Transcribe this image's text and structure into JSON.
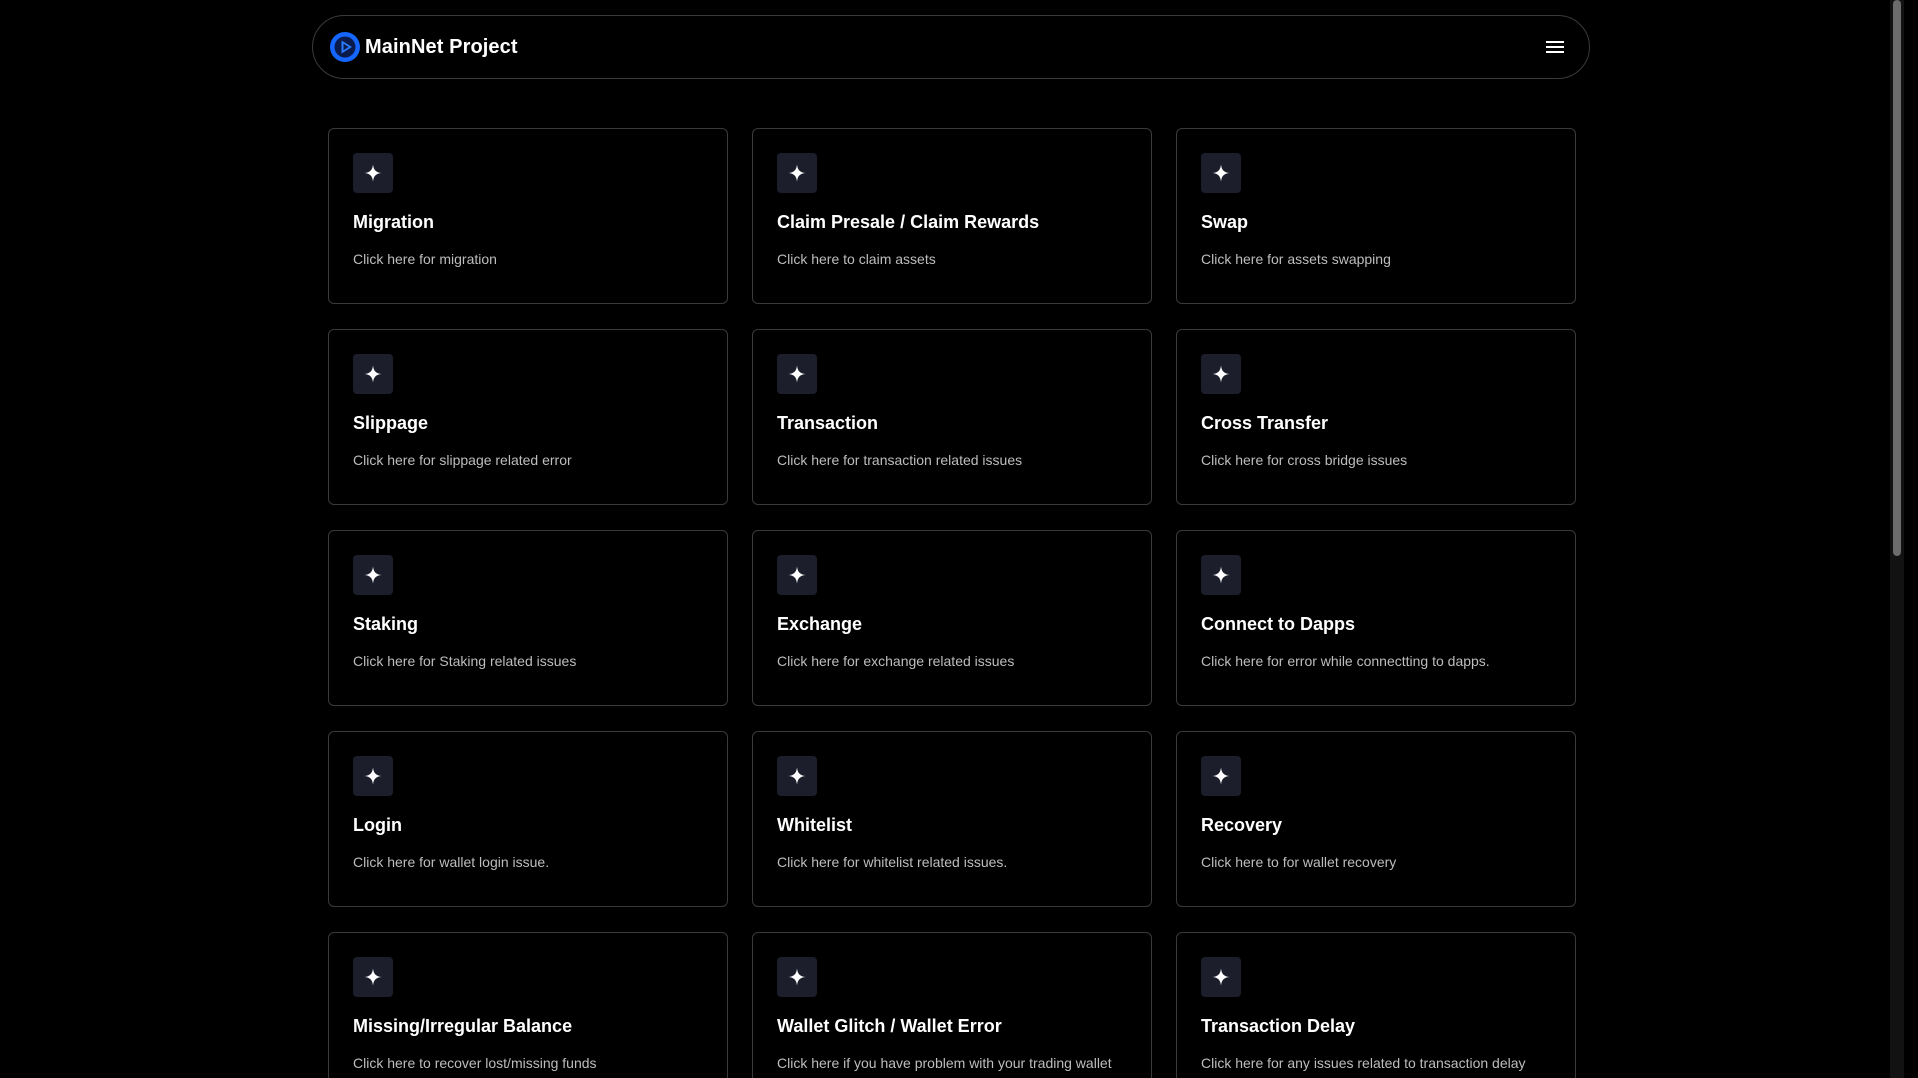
{
  "header": {
    "brand_name": "MainNet Project",
    "logo_icon": "play-circle-logo-icon",
    "menu_icon": "hamburger-menu-icon"
  },
  "colors": {
    "background": "#000000",
    "border": "#3a3a3a",
    "icon_tile": "#1c1f2b",
    "logo_blue": "#1565ff",
    "description_text": "#bdbdbd"
  },
  "cards": [
    {
      "title": "Migration",
      "description": "Click here for migration",
      "icon": "sparkle-icon"
    },
    {
      "title": "Claim Presale / Claim Rewards",
      "description": "Click here to claim assets",
      "icon": "sparkle-icon"
    },
    {
      "title": "Swap",
      "description": "Click here for assets swapping",
      "icon": "sparkle-icon"
    },
    {
      "title": "Slippage",
      "description": "Click here for slippage related error",
      "icon": "sparkle-icon"
    },
    {
      "title": "Transaction",
      "description": "Click here for transaction related issues",
      "icon": "sparkle-icon"
    },
    {
      "title": "Cross Transfer",
      "description": "Click here for cross bridge issues",
      "icon": "sparkle-icon"
    },
    {
      "title": "Staking",
      "description": "Click here for Staking related issues",
      "icon": "sparkle-icon"
    },
    {
      "title": "Exchange",
      "description": "Click here for exchange related issues",
      "icon": "sparkle-icon"
    },
    {
      "title": "Connect to Dapps",
      "description": "Click here for error while connectting to dapps.",
      "icon": "sparkle-icon"
    },
    {
      "title": "Login",
      "description": "Click here for wallet login issue.",
      "icon": "sparkle-icon"
    },
    {
      "title": "Whitelist",
      "description": "Click here for whitelist related issues.",
      "icon": "sparkle-icon"
    },
    {
      "title": "Recovery",
      "description": "Click here to for wallet recovery",
      "icon": "sparkle-icon"
    },
    {
      "title": "Missing/Irregular Balance",
      "description": "Click here to recover lost/missing funds",
      "icon": "sparkle-icon"
    },
    {
      "title": "Wallet Glitch / Wallet Error",
      "description": "Click here if you have problem with your trading wallet",
      "icon": "sparkle-icon"
    },
    {
      "title": "Transaction Delay",
      "description": "Click here for any issues related to transaction delay",
      "icon": "sparkle-icon"
    }
  ]
}
